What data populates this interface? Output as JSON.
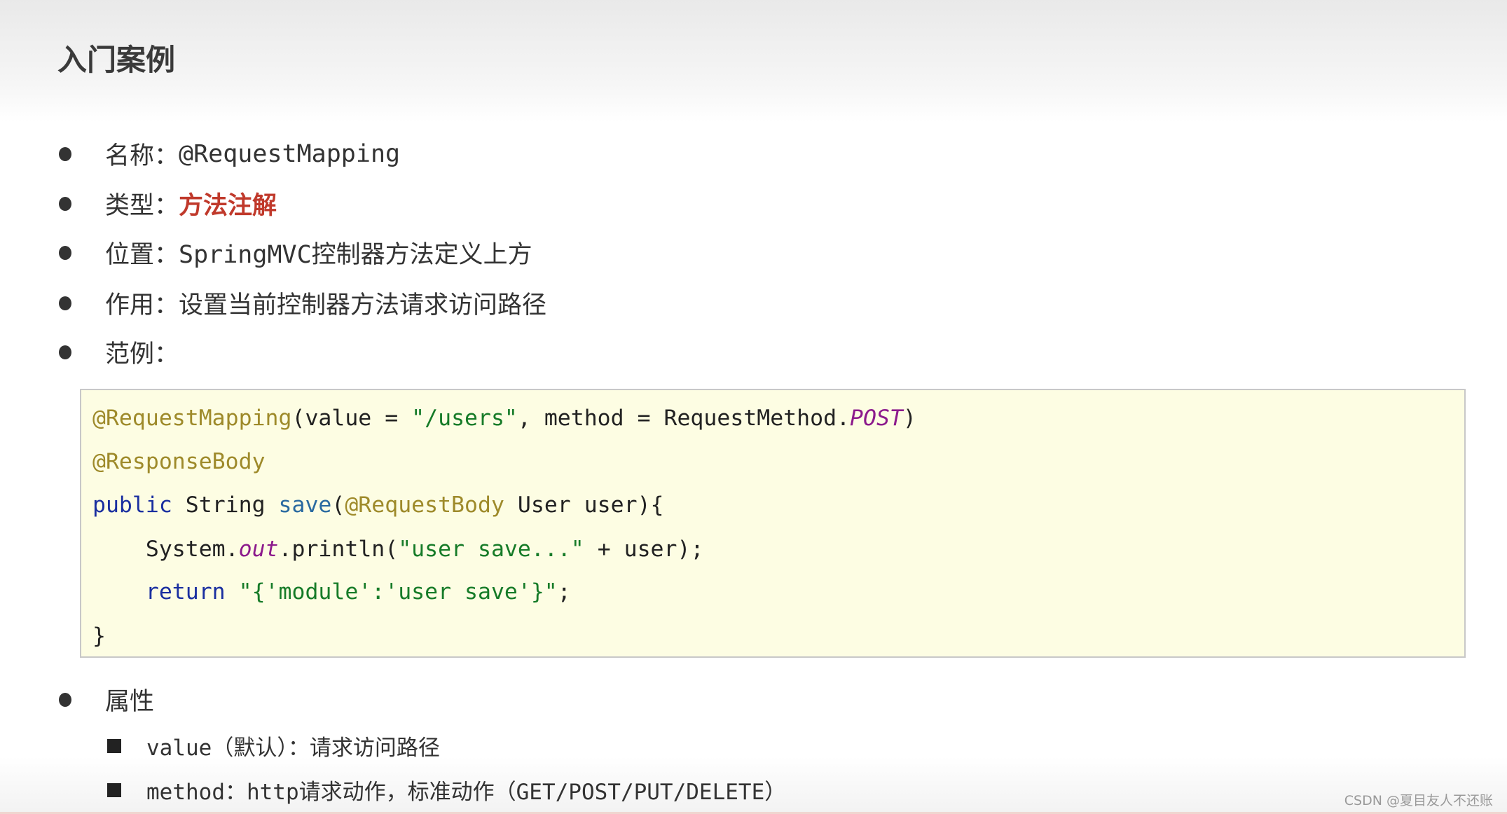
{
  "title": "入门案例",
  "bullets": {
    "name_label": "名称：",
    "name_value": "@RequestMapping",
    "type_label": "类型：",
    "type_value": "方法注解",
    "position_label": "位置：",
    "position_value": "SpringMVC控制器方法定义上方",
    "role_label": "作用：",
    "role_value": "设置当前控制器方法请求访问路径",
    "example_label": "范例："
  },
  "code": {
    "l1": [
      "@RequestMapping",
      "(value = ",
      "\"/users\"",
      ", method = RequestMethod.",
      "POST",
      ")"
    ],
    "l2": "@ResponseBody",
    "l3": [
      "public",
      " String ",
      "save",
      "(",
      "@RequestBody",
      " User user){"
    ],
    "l4": [
      "    System.",
      "out",
      ".println(",
      "\"user save...\"",
      " + user);"
    ],
    "l5": [
      "    ",
      "return",
      " ",
      "\"{'module':'user save'}\"",
      ";"
    ],
    "l6": "}"
  },
  "attributes": {
    "label": "属性",
    "items": [
      "value（默认）：请求访问路径",
      "method：http请求动作，标准动作（GET/POST/PUT/DELETE）"
    ]
  },
  "watermark": "CSDN @夏目友人不还账",
  "colors": {
    "highlight": "#c0392b",
    "code_bg": "#fdfde3"
  }
}
